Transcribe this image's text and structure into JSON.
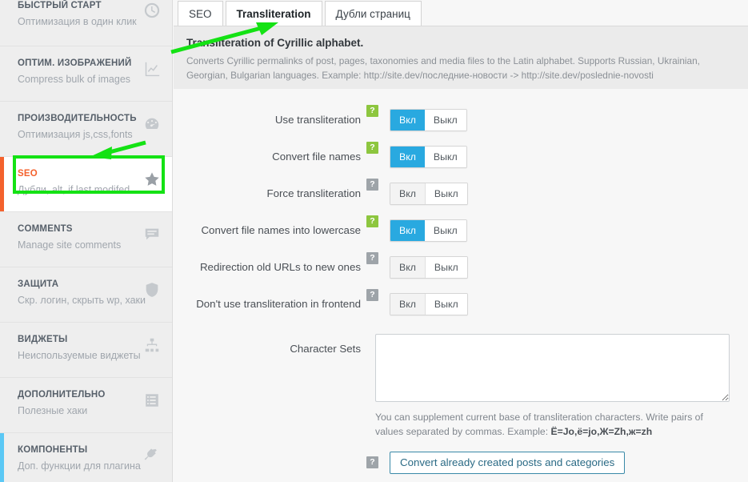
{
  "sidebar": {
    "items": [
      {
        "title": "БЫСТРЫЙ СТАРТ",
        "subtitle": "Оптимизация в один клик",
        "icon": "clock-icon",
        "state": "normal",
        "name": "sidebar-item-quick-start"
      },
      {
        "title": "ОПТИМ. ИЗОБРАЖЕНИЙ",
        "subtitle": "Compress bulk of images",
        "icon": "chart-icon",
        "state": "normal",
        "name": "sidebar-item-image-optimization"
      },
      {
        "title": "ПРОИЗВОДИТЕЛЬНОСТЬ",
        "subtitle": "Оптимизация js,css,fonts",
        "icon": "gauge-icon",
        "state": "normal",
        "name": "sidebar-item-performance"
      },
      {
        "title": "SEO",
        "subtitle": "Дубли, alt, if last modifed",
        "icon": "star-icon",
        "state": "active-orange",
        "name": "sidebar-item-seo"
      },
      {
        "title": "COMMENTS",
        "subtitle": "Manage site comments",
        "icon": "comment-icon",
        "state": "normal",
        "name": "sidebar-item-comments"
      },
      {
        "title": "ЗАЩИТА",
        "subtitle": "Скр. логин, скрыть wp, хаки",
        "icon": "shield-icon",
        "state": "normal",
        "name": "sidebar-item-security"
      },
      {
        "title": "ВИДЖЕТЫ",
        "subtitle": "Неиспользуемые виджеты",
        "icon": "sitemap-icon",
        "state": "normal",
        "name": "sidebar-item-widgets"
      },
      {
        "title": "ДОПОЛНИТЕЛЬНО",
        "subtitle": "Полезные хаки",
        "icon": "list-icon",
        "state": "normal",
        "name": "sidebar-item-additional"
      },
      {
        "title": "КОМПОНЕНТЫ",
        "subtitle": "Доп. функции для плагина",
        "icon": "plug-icon",
        "state": "active-blue",
        "name": "sidebar-item-components"
      }
    ]
  },
  "tabs": [
    {
      "label": "SEO",
      "active": false,
      "name": "tab-seo"
    },
    {
      "label": "Transliteration",
      "active": true,
      "name": "tab-transliteration"
    },
    {
      "label": "Дубли страниц",
      "active": false,
      "name": "tab-duplicate-pages"
    }
  ],
  "description": {
    "title": "Transliteration of Cyrillic alphabet.",
    "text": "Converts Cyrillic permalinks of post, pages, taxonomies and media files to the Latin alphabet. Supports Russian, Ukrainian, Georgian, Bulgarian languages. Example: http://site.dev/последние-новости -> http://site.dev/poslednie-novosti"
  },
  "toggle_labels": {
    "on": "Вкл",
    "off": "Выкл"
  },
  "help_glyph": "?",
  "settings": [
    {
      "label": "Use transliteration",
      "value": "on",
      "help_active": true,
      "name": "setting-use-transliteration"
    },
    {
      "label": "Convert file names",
      "value": "on",
      "help_active": true,
      "name": "setting-convert-file-names"
    },
    {
      "label": "Force transliteration",
      "value": "off",
      "help_active": false,
      "name": "setting-force-transliteration"
    },
    {
      "label": "Convert file names into lowercase",
      "value": "on",
      "help_active": true,
      "name": "setting-convert-lowercase"
    },
    {
      "label": "Redirection old URLs to new ones",
      "value": "off",
      "help_active": false,
      "name": "setting-redirect-old-urls"
    },
    {
      "label": "Don't use transliteration in frontend",
      "value": "off",
      "help_active": false,
      "name": "setting-no-transliteration-frontend"
    }
  ],
  "charset": {
    "label": "Character Sets",
    "value": "",
    "placeholder": "",
    "hint_prefix": "You can supplement current base of transliteration characters. Write pairs of values separated by commas. Example: ",
    "hint_example": "Ё=Jo,ё=jo,Ж=Zh,ж=zh"
  },
  "convert_button": {
    "label": "Convert already created posts and categories"
  },
  "colors": {
    "toggle_active": "#29a9e0",
    "help_active": "#8dc63f",
    "help_inactive": "#9ea4a9",
    "sidebar_accent_orange": "#f4622d",
    "sidebar_accent_blue": "#5bc8f5",
    "annotation_green": "#14e214",
    "cta_border": "#3a8aa8"
  }
}
